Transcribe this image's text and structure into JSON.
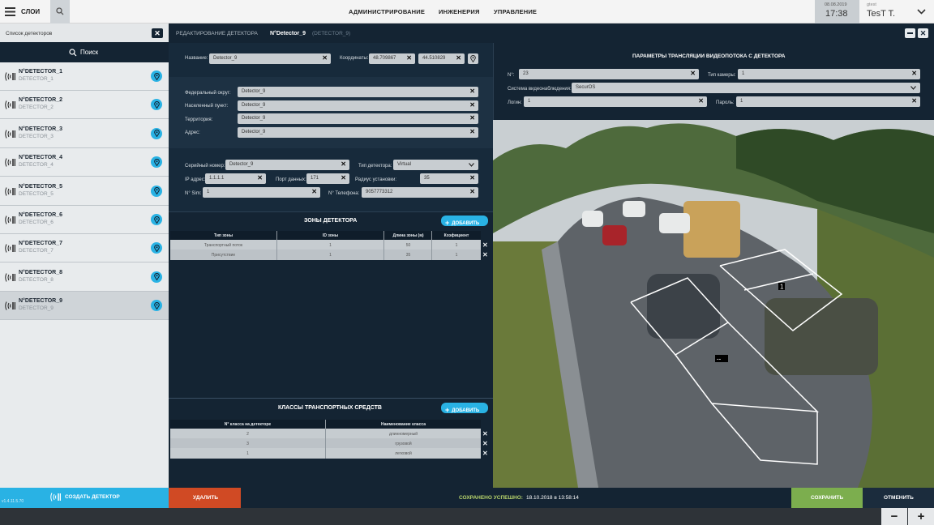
{
  "topbar": {
    "layers_label": "СЛОИ",
    "nav": [
      "АДМИНИСТРИРОВАНИЕ",
      "ИНЖЕНЕРИЯ",
      "УПРАВЛЕНИЕ"
    ],
    "date": "08.08.2019",
    "time": "17:38",
    "user_small": "gtest",
    "user": "TesT T."
  },
  "sidebar": {
    "title": "Список детекторов",
    "search": "Поиск",
    "detectors": [
      {
        "name": "N°DETECTOR_1",
        "sub": "DETECTOR_1"
      },
      {
        "name": "N°DETECTOR_2",
        "sub": "DETECTOR_2"
      },
      {
        "name": "N°DETECTOR_3",
        "sub": "DETECTOR_3"
      },
      {
        "name": "N°DETECTOR_4",
        "sub": "DETECTOR_4"
      },
      {
        "name": "N°DETECTOR_5",
        "sub": "DETECTOR_5"
      },
      {
        "name": "N°DETECTOR_6",
        "sub": "DETECTOR_6"
      },
      {
        "name": "N°DETECTOR_7",
        "sub": "DETECTOR_7"
      },
      {
        "name": "N°DETECTOR_8",
        "sub": "DETECTOR_8"
      },
      {
        "name": "N°DETECTOR_9",
        "sub": "DETECTOR_9"
      }
    ],
    "version": "v1.4.11.5.70",
    "create": "СОЗДАТЬ ДЕТЕКТОР"
  },
  "editor": {
    "title_prefix": "РЕДАКТИРОВАНИЕ ДЕТЕКТОРА",
    "title_name": "N°Detector_9",
    "title_sub": "(DETECTOR_9)",
    "name_label": "Название:",
    "name_value": "Detector_9",
    "coords_label": "Координаты:",
    "lat": "48.709867",
    "lon": "44.510829",
    "fed_label": "Федеральный округ:",
    "fed_value": "Detector_9",
    "city_label": "Населенный пункт:",
    "city_value": "Detector_9",
    "terr_label": "Территория:",
    "terr_value": "Detector_9",
    "addr_label": "Адрес:",
    "addr_value": "Detector_9",
    "serial_label": "Серийный номер:",
    "serial_value": "Detector_9",
    "type_label": "Тип детектора:",
    "type_value": "Virtual",
    "ip_label": "IP адрес:",
    "ip_value": "1.1.1.1",
    "port_label": "Порт данных:",
    "port_value": "171",
    "radius_label": "Радиус установки:",
    "radius_value": "35",
    "sim_label": "N° Sim:",
    "sim_value": "1",
    "phone_label": "N° Телефона:",
    "phone_value": "9057773312"
  },
  "zones": {
    "title": "ЗОНЫ ДЕТЕКТОРА",
    "add": "ДОБАВИТЬ",
    "headers": [
      "Тип зоны",
      "ID зоны",
      "Длина зоны (м)",
      "Коэфициент"
    ],
    "rows": [
      [
        "Транспортный поток",
        "1",
        "50",
        "1"
      ],
      [
        "Присутствие",
        "1",
        "35",
        "1"
      ]
    ]
  },
  "classes": {
    "title": "КЛАССЫ ТРАНСПОРТНЫХ СРЕДСТВ",
    "add": "ДОБАВИТЬ",
    "headers": [
      "N° класса на детекторе",
      "Наименование класса"
    ],
    "rows": [
      [
        "2",
        "длинномерный"
      ],
      [
        "3",
        "грузовой"
      ],
      [
        "1",
        "легковой"
      ]
    ]
  },
  "stream": {
    "title": "ПАРАМЕТРЫ ТРАНСЛЯЦИИ ВИДЕОПОТОКА С ДЕТЕКТОРА",
    "num_label": "N°:",
    "num_value": "23",
    "camtype_label": "Тип камеры:",
    "camtype_value": "1",
    "vms_label": "Система видеонаблюдения:",
    "vms_value": "SecurOS",
    "login_label": "Логин:",
    "login_value": "1",
    "pass_label": "Пароль:",
    "pass_value": "1",
    "zone_marker_1": "1",
    "zone_marker_2": "--"
  },
  "footer": {
    "delete": "УДАЛИТЬ",
    "status_label": "СОХРАНЕНО УСПЕШНО:",
    "status_time": "18.10.2018 в 13:58:14",
    "save": "СОХРАНИТЬ",
    "cancel": "ОТМЕНИТЬ"
  },
  "colors": {
    "topbar": "#f2f2f2",
    "panel": "#142433",
    "accent": "#29b2e4",
    "delete": "#d04a24",
    "save": "#7cae4e"
  }
}
